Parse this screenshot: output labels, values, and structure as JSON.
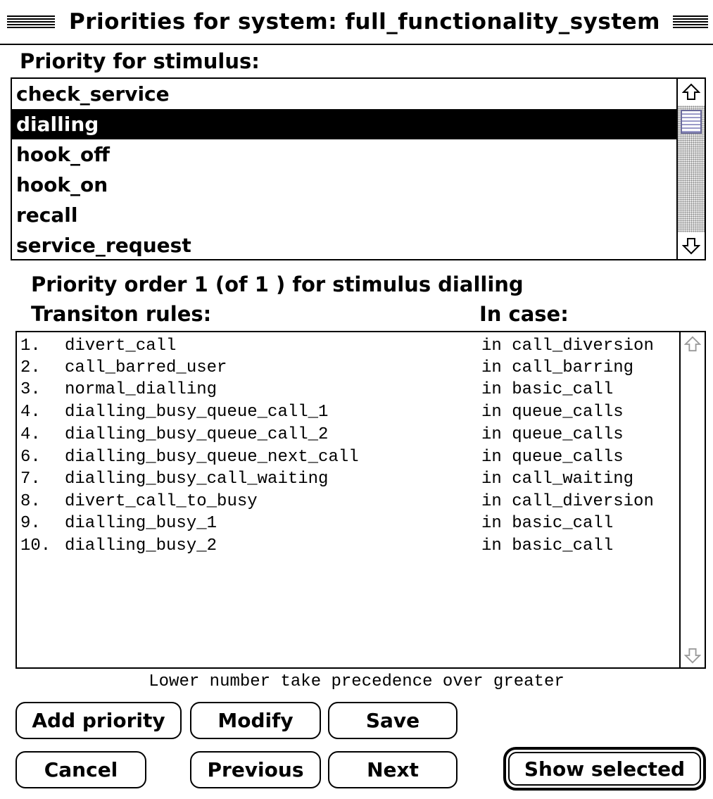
{
  "window": {
    "title": "Priorities for system: full_functionality_system"
  },
  "stimulus_section": {
    "label": "Priority for stimulus:",
    "items": [
      "check_service",
      "dialling",
      "hook_off",
      "hook_on",
      "recall",
      "service_request"
    ],
    "selected": "dialling",
    "scroll_up_icon": "arrow-up-icon",
    "scroll_down_icon": "arrow-down-icon"
  },
  "priority_order": {
    "text": "Priority order 1  (of  1 ) for stimulus  dialling"
  },
  "columns": {
    "rules_header": "Transiton rules:",
    "case_header": "In case:"
  },
  "rules": [
    {
      "num": "1.",
      "rule": "divert_call",
      "case": "in call_diversion"
    },
    {
      "num": "2.",
      "rule": "call_barred_user",
      "case": "in call_barring"
    },
    {
      "num": "3.",
      "rule": "normal_dialling",
      "case": "in basic_call"
    },
    {
      "num": "4.",
      "rule": "dialling_busy_queue_call_1",
      "case": "in queue_calls"
    },
    {
      "num": "4.",
      "rule": "dialling_busy_queue_call_2",
      "case": "in queue_calls"
    },
    {
      "num": "6.",
      "rule": "dialling_busy_queue_next_call",
      "case": "in queue_calls"
    },
    {
      "num": "7.",
      "rule": "dialling_busy_call_waiting",
      "case": "in call_waiting"
    },
    {
      "num": "8.",
      "rule": "divert_call_to_busy",
      "case": "in call_diversion"
    },
    {
      "num": "9.",
      "rule": "dialling_busy_1",
      "case": "in basic_call"
    },
    {
      "num": "10.",
      "rule": "dialling_busy_2",
      "case": "in basic_call"
    }
  ],
  "footnote": "Lower number take precedence over greater",
  "buttons": {
    "add_priority": "Add priority",
    "modify": "Modify",
    "save": "Save",
    "cancel": "Cancel",
    "previous": "Previous",
    "next": "Next",
    "show_selected": "Show selected"
  }
}
